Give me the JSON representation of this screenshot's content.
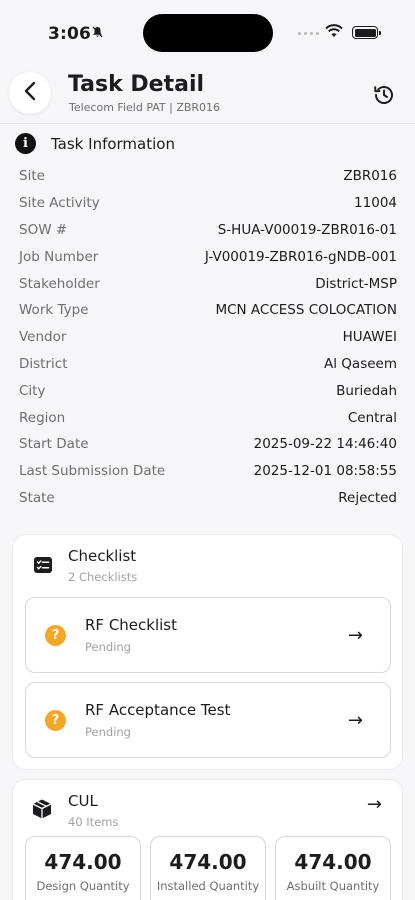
{
  "status_bar": {
    "time": "3:06"
  },
  "header": {
    "title": "Task Detail",
    "subtitle": "Telecom Field PAT | ZBR016"
  },
  "task_info": {
    "title": "Task Information",
    "rows": [
      {
        "key": "Site",
        "value": "ZBR016"
      },
      {
        "key": "Site Activity",
        "value": "11004"
      },
      {
        "key": "SOW #",
        "value": "S-HUA-V00019-ZBR016-01"
      },
      {
        "key": "Job Number",
        "value": "J-V00019-ZBR016-gNDB-001"
      },
      {
        "key": "Stakeholder",
        "value": "District-MSP"
      },
      {
        "key": "Work Type",
        "value": "MCN ACCESS COLOCATION"
      },
      {
        "key": "Vendor",
        "value": "HUAWEI"
      },
      {
        "key": "District",
        "value": "Al Qaseem"
      },
      {
        "key": "City",
        "value": "Buriedah"
      },
      {
        "key": "Region",
        "value": "Central"
      },
      {
        "key": "Start Date",
        "value": "2025-09-22 14:46:40"
      },
      {
        "key": "Last Submission Date",
        "value": "2025-12-01 08:58:55"
      },
      {
        "key": "State",
        "value": "Rejected"
      }
    ]
  },
  "checklist": {
    "title": "Checklist",
    "subtitle": "2 Checklists",
    "items": [
      {
        "name": "RF Checklist",
        "status": "Pending"
      },
      {
        "name": "RF Acceptance Test",
        "status": "Pending"
      }
    ]
  },
  "cul": {
    "title": "CUL",
    "subtitle": "40 Items",
    "quantities": [
      {
        "value": "474.00",
        "label": "Design Quantity"
      },
      {
        "value": "474.00",
        "label": "Installed Quantity"
      },
      {
        "value": "474.00",
        "label": "Asbuilt Quantity"
      }
    ]
  },
  "colors": {
    "accent_pending": "#f5a623",
    "background": "#f6f6f8"
  },
  "icons": {
    "back": "chevron-left-icon",
    "history": "history-icon",
    "info": "info-icon",
    "checklist": "checklist-icon",
    "cul": "package-icon",
    "pending": "question-icon",
    "navigate": "arrow-right-icon"
  }
}
